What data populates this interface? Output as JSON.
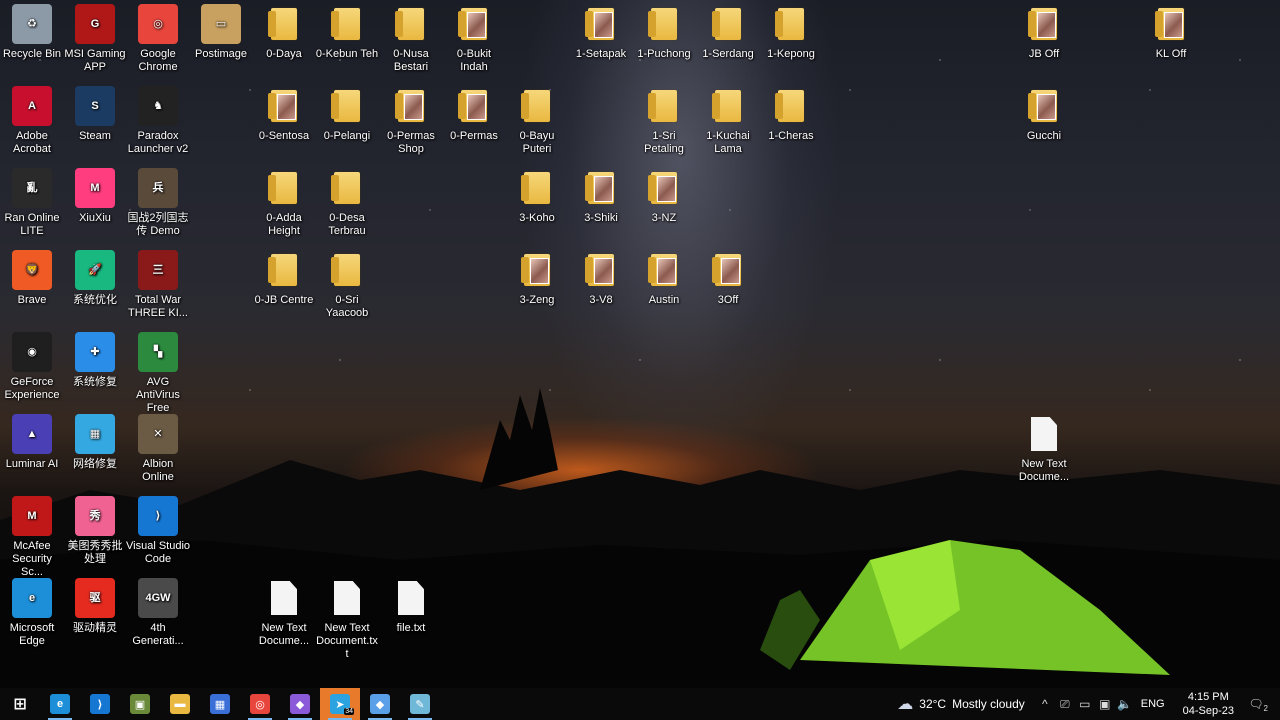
{
  "desktop": {
    "columns": [
      {
        "items": [
          {
            "label": "Recycle Bin",
            "icon": "recycle-bin-icon",
            "color": "#8c9aa8",
            "text": "♻"
          },
          {
            "label": "Adobe Acrobat",
            "icon": "adobe-acrobat-icon",
            "color": "#c8102e",
            "text": "A"
          },
          {
            "label": "Ran Online LITE",
            "icon": "ran-online-icon",
            "color": "#2a2a2a",
            "text": "亂"
          },
          {
            "label": "Brave",
            "icon": "brave-icon",
            "color": "#f05a24",
            "text": "🦁"
          },
          {
            "label": "GeForce Experience",
            "icon": "geforce-icon",
            "color": "#1f1f1f",
            "text": "◉"
          },
          {
            "label": "Luminar AI",
            "icon": "luminar-icon",
            "color": "#4a3fb5",
            "text": "▲"
          },
          {
            "label": "McAfee Security Sc...",
            "icon": "mcafee-icon",
            "color": "#c01818",
            "text": "M"
          },
          {
            "label": "Microsoft Edge",
            "icon": "edge-icon",
            "color": "#1d8fd8",
            "text": "e"
          }
        ]
      },
      {
        "items": [
          {
            "label": "MSI Gaming APP",
            "icon": "msi-icon",
            "color": "#b01818",
            "text": "G"
          },
          {
            "label": "Steam",
            "icon": "steam-icon",
            "color": "#1b3b63",
            "text": "S"
          },
          {
            "label": "XiuXiu",
            "icon": "xiuxiu-icon",
            "color": "#ff3d7f",
            "text": "M"
          },
          {
            "label": "系统优化",
            "icon": "system-optimize-icon",
            "color": "#18b880",
            "text": "🚀"
          },
          {
            "label": "系统修复",
            "icon": "system-repair-icon",
            "color": "#2a8de8",
            "text": "✚"
          },
          {
            "label": "网络修复",
            "icon": "network-repair-icon",
            "color": "#34a8e0",
            "text": "▦"
          },
          {
            "label": "美图秀秀批处理",
            "icon": "meitu-batch-icon",
            "color": "#f06292",
            "text": "秀"
          },
          {
            "label": "驱动精灵",
            "icon": "driver-genius-icon",
            "color": "#e52b20",
            "text": "驱"
          }
        ]
      },
      {
        "items": [
          {
            "label": "Google Chrome",
            "icon": "chrome-icon",
            "color": "#e8453c",
            "text": "◎"
          },
          {
            "label": "Paradox Launcher v2",
            "icon": "paradox-icon",
            "color": "#222222",
            "text": "♞"
          },
          {
            "label": "国战2列国志传 Demo",
            "icon": "guozhan-icon",
            "color": "#5a4a3a",
            "text": "兵"
          },
          {
            "label": "Total War THREE KI...",
            "icon": "total-war-icon",
            "color": "#8a1a1a",
            "text": "三"
          },
          {
            "label": "AVG AntiVirus Free",
            "icon": "avg-icon",
            "color": "#2b8a3e",
            "text": "▚"
          },
          {
            "label": "Albion Online",
            "icon": "albion-icon",
            "color": "#6b5a44",
            "text": "✕"
          },
          {
            "label": "Visual Studio Code",
            "icon": "vscode-icon",
            "color": "#1677d3",
            "text": "⟩"
          },
          {
            "label": "4th Generati...",
            "icon": "4gw-icon",
            "color": "#4a4a4a",
            "text": "4GW"
          }
        ]
      },
      {
        "items": [
          {
            "label": "Postimage",
            "icon": "postimage-icon",
            "color": "#c8a060",
            "text": "▭"
          }
        ]
      }
    ],
    "folders": [
      {
        "label": "0-Daya",
        "pic": false
      },
      {
        "label": "0-Kebun Teh",
        "pic": false
      },
      {
        "label": "0-Nusa Bestari",
        "pic": false
      },
      {
        "label": "0-Bukit Indah",
        "pic": true
      },
      {
        "label": "1-Setapak",
        "pic": true
      },
      {
        "label": "1-Puchong",
        "pic": false
      },
      {
        "label": "1-Serdang",
        "pic": false
      },
      {
        "label": "1-Kepong",
        "pic": false
      },
      {
        "label": "JB Off",
        "pic": true
      },
      {
        "label": "KL Off",
        "pic": true
      },
      {
        "label": "0-Sentosa",
        "pic": true
      },
      {
        "label": "0-Pelangi",
        "pic": false
      },
      {
        "label": "0-Permas Shop",
        "pic": true
      },
      {
        "label": "0-Permas",
        "pic": true
      },
      {
        "label": "0-Bayu Puteri",
        "pic": false
      },
      {
        "label": "1-Sri Petaling",
        "pic": false
      },
      {
        "label": "1-Kuchai Lama",
        "pic": false
      },
      {
        "label": "1-Cheras",
        "pic": false
      },
      {
        "label": "Gucchi",
        "pic": true
      },
      {
        "label": "0-Adda Height",
        "pic": false
      },
      {
        "label": "0-Desa Terbrau",
        "pic": false
      },
      {
        "label": "3-Koho",
        "pic": false
      },
      {
        "label": "3-Shiki",
        "pic": true
      },
      {
        "label": "3-NZ",
        "pic": true
      },
      {
        "label": "0-JB Centre",
        "pic": false
      },
      {
        "label": "0-Sri Yaacoob",
        "pic": false
      },
      {
        "label": "3-Zeng",
        "pic": true
      },
      {
        "label": "3-V8",
        "pic": true
      },
      {
        "label": "Austin",
        "pic": true
      },
      {
        "label": "3Off",
        "pic": true
      }
    ],
    "files": [
      {
        "label": "New Text Docume..."
      },
      {
        "label": "New Text Document.txt"
      },
      {
        "label": "file.txt"
      },
      {
        "label": "New Text Docume..."
      }
    ]
  },
  "taskbar": {
    "apps": [
      {
        "name": "start",
        "icon": "windows-start-icon",
        "color": "#0a0a0a",
        "text": "⊞",
        "open": false,
        "active": false
      },
      {
        "name": "edge",
        "icon": "edge-icon",
        "color": "#1d8fd8",
        "text": "e",
        "open": true,
        "active": false
      },
      {
        "name": "vscode",
        "icon": "vscode-icon",
        "color": "#1677d3",
        "text": "⟩",
        "open": false,
        "active": false
      },
      {
        "name": "minecraft",
        "icon": "minecraft-icon",
        "color": "#6a8a3a",
        "text": "▣",
        "open": false,
        "active": false
      },
      {
        "name": "file-explorer",
        "icon": "folder-icon",
        "color": "#e9b840",
        "text": "▬",
        "open": false,
        "active": false
      },
      {
        "name": "store",
        "icon": "store-icon",
        "color": "#3a6fd8",
        "text": "▦",
        "open": false,
        "active": false
      },
      {
        "name": "chrome",
        "icon": "chrome-icon",
        "color": "#e8453c",
        "text": "◎",
        "open": true,
        "active": false
      },
      {
        "name": "app-gem",
        "icon": "gem-app-icon",
        "color": "#8a5ad8",
        "text": "◆",
        "open": true,
        "active": false
      },
      {
        "name": "telegram",
        "icon": "telegram-icon",
        "color": "#2aa3e0",
        "text": "➤",
        "open": true,
        "active": true,
        "badge": "34"
      },
      {
        "name": "app-gem-2",
        "icon": "gem-app-icon",
        "color": "#5aa0e8",
        "text": "◆",
        "open": true,
        "active": false
      },
      {
        "name": "notepad",
        "icon": "notepad-icon",
        "color": "#6fb8d8",
        "text": "✎",
        "open": true,
        "active": false
      }
    ],
    "weather": {
      "temp": "32°C",
      "condition": "Mostly cloudy",
      "alert": "1"
    },
    "tray": {
      "chevron": "^",
      "language": "ENG",
      "time": "4:15 PM",
      "date": "04-Sep-23",
      "notifications": "2"
    }
  }
}
